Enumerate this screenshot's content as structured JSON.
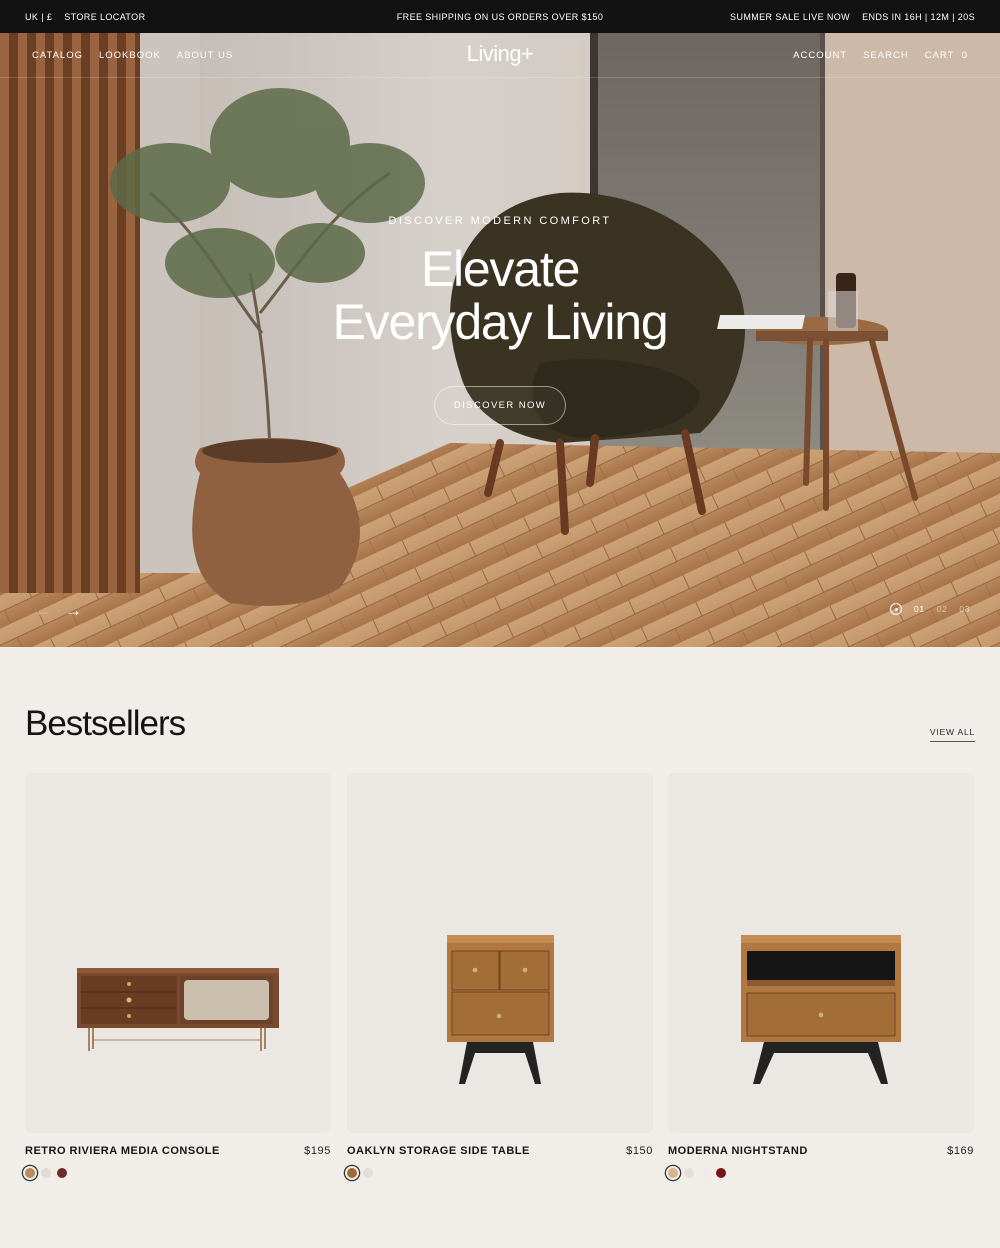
{
  "topbar": {
    "region": "UK | £",
    "store_locator": "STORE LOCATOR",
    "promo": "FREE SHIPPING ON US ORDERS OVER $150",
    "sale": "SUMMER SALE LIVE NOW",
    "countdown": "ENDS IN 16H | 12M | 20S"
  },
  "nav": {
    "left": [
      "CATALOG",
      "LOOKBOOK",
      "ABOUT US"
    ],
    "logo": "Living+",
    "account": "ACCOUNT",
    "search": "SEARCH",
    "cart_label": "CART",
    "cart_count": "0"
  },
  "hero": {
    "eyebrow": "DISCOVER MODERN COMFORT",
    "headline_line1": "Elevate",
    "headline_line2": "Everyday Living",
    "cta": "DISCOVER NOW",
    "prev_icon": "←",
    "next_icon": "→",
    "slides": [
      "01",
      "02",
      "03"
    ],
    "active_slide": "01"
  },
  "bestsellers": {
    "title": "Bestsellers",
    "view_all": "VIEW ALL",
    "products": [
      {
        "name": "RETRO RIVIERA MEDIA CONSOLE",
        "price": "$195",
        "swatches": [
          "#b98a5c",
          "#e3dad6",
          "#6b2c2c"
        ],
        "selected": 0
      },
      {
        "name": "OAKLYN STORAGE SIDE TABLE",
        "price": "$150",
        "swatches": [
          "#a06a35",
          "#e6dcd8",
          "#efebe7"
        ],
        "selected": 0
      },
      {
        "name": "MODERNA NIGHTSTAND",
        "price": "$169",
        "swatches": [
          "#d7b48e",
          "#e6dcd8",
          "#efebe7",
          "#7a1419"
        ],
        "selected": 0
      }
    ]
  }
}
